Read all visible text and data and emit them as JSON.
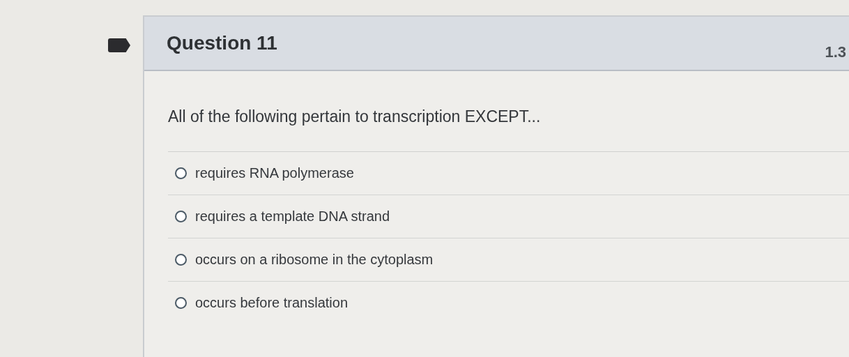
{
  "question": {
    "title": "Question 11",
    "points": "1.3",
    "prompt": "All of the following pertain to transcription EXCEPT...",
    "options": [
      {
        "label": "requires RNA polymerase",
        "selected": false
      },
      {
        "label": "requires a template DNA strand",
        "selected": false
      },
      {
        "label": "occurs on a ribosome in the cytoplasm",
        "selected": false
      },
      {
        "label": "occurs before translation",
        "selected": false
      }
    ]
  }
}
